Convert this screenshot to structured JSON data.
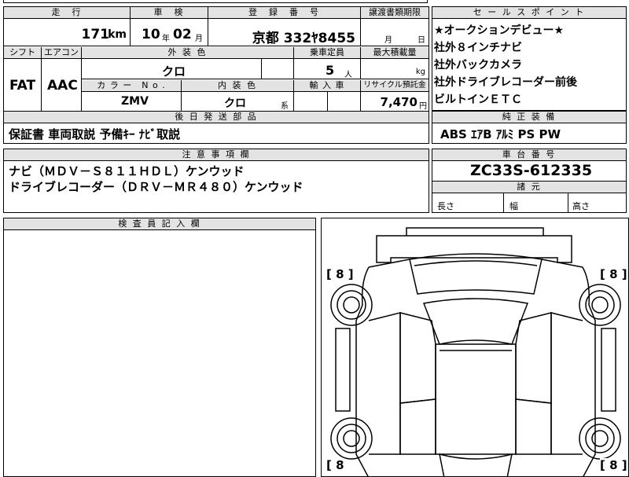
{
  "headers": {
    "mileage": "走　行",
    "inspection": "車　検",
    "registration": "登　録　番　号",
    "transfer": "譲渡書類期限",
    "selling_points": "セ ー ル ス ポ イ ン ト",
    "shift": "シフト",
    "aircon": "エアコン",
    "exterior_color": "外 装 色",
    "capacity": "乗車定員",
    "max_load": "最大積載量",
    "color_no": "カ ラ ー　N o .",
    "interior_color": "内 装 色",
    "import": "輸 入 車",
    "recycle": "リサイクル預託金",
    "parts": "後 日 発 送 部 品",
    "factory_equipment": "純 正 装 備",
    "notes": "注 意 事 項 欄",
    "chassis_no": "車 台 番 号",
    "dimensions": "諸 元",
    "inspector": "検 査 員 記 入 欄"
  },
  "vehicle": {
    "mileage_value": "171",
    "mileage_unit": "km",
    "inspection_year": "10",
    "inspection_year_unit": "年",
    "inspection_month": "02",
    "inspection_month_unit": "月",
    "registration": "京都 332ﾔ8455",
    "transfer_month": "月",
    "transfer_day": "日",
    "shift": "FAT",
    "aircon": "AAC",
    "exterior_color": "クロ",
    "capacity": "5",
    "capacity_unit": "人",
    "max_load_unit": "kg",
    "color_no": "ZMV",
    "interior_color": "クロ",
    "interior_suffix": "系",
    "recycle": "7,470",
    "recycle_unit": "円",
    "chassis_no": "ZC33S-612335"
  },
  "selling_points": [
    "★オークションデビュー★",
    "社外８インチナビ",
    "社外バックカメラ",
    "社外ドライブレコーダー前後",
    "ビルトインＥＴＣ"
  ],
  "parts_value": "保証書 車両取説 予備ｷｰ ﾅﾋﾞ取説",
  "factory_equipment_value": "ABS ｴｱB ｱﾙﾐ PS PW",
  "notes_lines": [
    "ナビ（ＭＤＶ－Ｓ８１１ＨＤＬ）ケンウッド",
    "ドライブレコーダー（ＤＲＶ－ＭＲ４８０）ケンウッド"
  ],
  "dimensions": {
    "length": "長さ",
    "width": "幅",
    "height": "高さ"
  },
  "diagram": {
    "tire_marks": [
      "[ 8 ]",
      "[ 8 ]",
      "[ 8",
      "[ 8 ]"
    ]
  }
}
